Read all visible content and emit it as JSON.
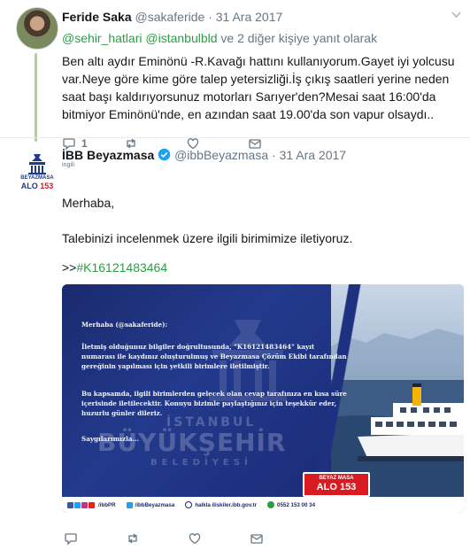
{
  "tweet1": {
    "author_name": "Feride Saka",
    "author_handle": "@sakaferide",
    "separator": "·",
    "date": "31 Ara 2017",
    "replying": {
      "mention1": "@sehir_hatlari",
      "mention2": "@istanbulbld",
      "rest": "ve 2 diğer kişiye yanıt olarak"
    },
    "text": "Ben altı aydır Eminönü -R.Kavağı hattını kullanıyorum.Gayet iyi yolcusu var.Neye göre kime göre talep yetersizliği.İş çıkış saatleri yerine neden saat başı kaldırıyorsunuz motorları Sarıyer'den?Mesai saat 16:00'da bitmiyor Eminönü'nde, en azından saat 19.00'da son vapur olsaydı..",
    "reply_count": "1"
  },
  "tweet2": {
    "author_name": "İBB Beyazmasa",
    "author_handle": "@ibbBeyazmasa",
    "separator": "·",
    "date": "31 Ara 2017",
    "subtitle": "ingili",
    "greeting": "Merhaba,",
    "paragraph": "Talebinizi incelenmek üzere ilgili birimimize iletiyoruz.",
    "ref_prefix": ">>",
    "ref_hashtag": "#K16121483464",
    "avatar": {
      "line1": "BEYAZMASA",
      "line2a": "ALO ",
      "line2b": "153"
    }
  },
  "card": {
    "greeting": "Merhaba (@sakaferide):",
    "p1": "İletmiş olduğunuz bilgiler doğrultusunda, \"K16121483464\" kayıt numarası ile kaydınız oluşturulmuş ve Beyazmasa Çözüm Ekibi tarafından gereğinin yapılması için yetkili birimlere iletilmiştir.",
    "p2": "Bu kapsamda, ilgili birimlerden gelecek olan cevap tarafınıza en kısa süre içerisinde iletilecektir. Konuyu bizimle paylaştığınız için teşekkür eder, huzurlu günler dileriz.",
    "closing": "Saygılarımızla...",
    "watermark_line1": "İSTANBUL",
    "watermark_line2": "BÜYÜKŞEHİR",
    "watermark_line3": "BELEDİYESİ",
    "badge_top": "BEYAZ MASA",
    "badge_bottom": "ALO 153",
    "footer": {
      "social": "/ibbPR",
      "twitter": "/ibbBeyazmasa",
      "web": "halkla iliskiler.ibb.gov.tr",
      "phone": "0552 153 00 34"
    }
  },
  "colors": {
    "link_green": "#2a9e44",
    "thread_line": "#a8d49a",
    "card_blue": "#1e3180",
    "badge_red": "#d91a21"
  }
}
